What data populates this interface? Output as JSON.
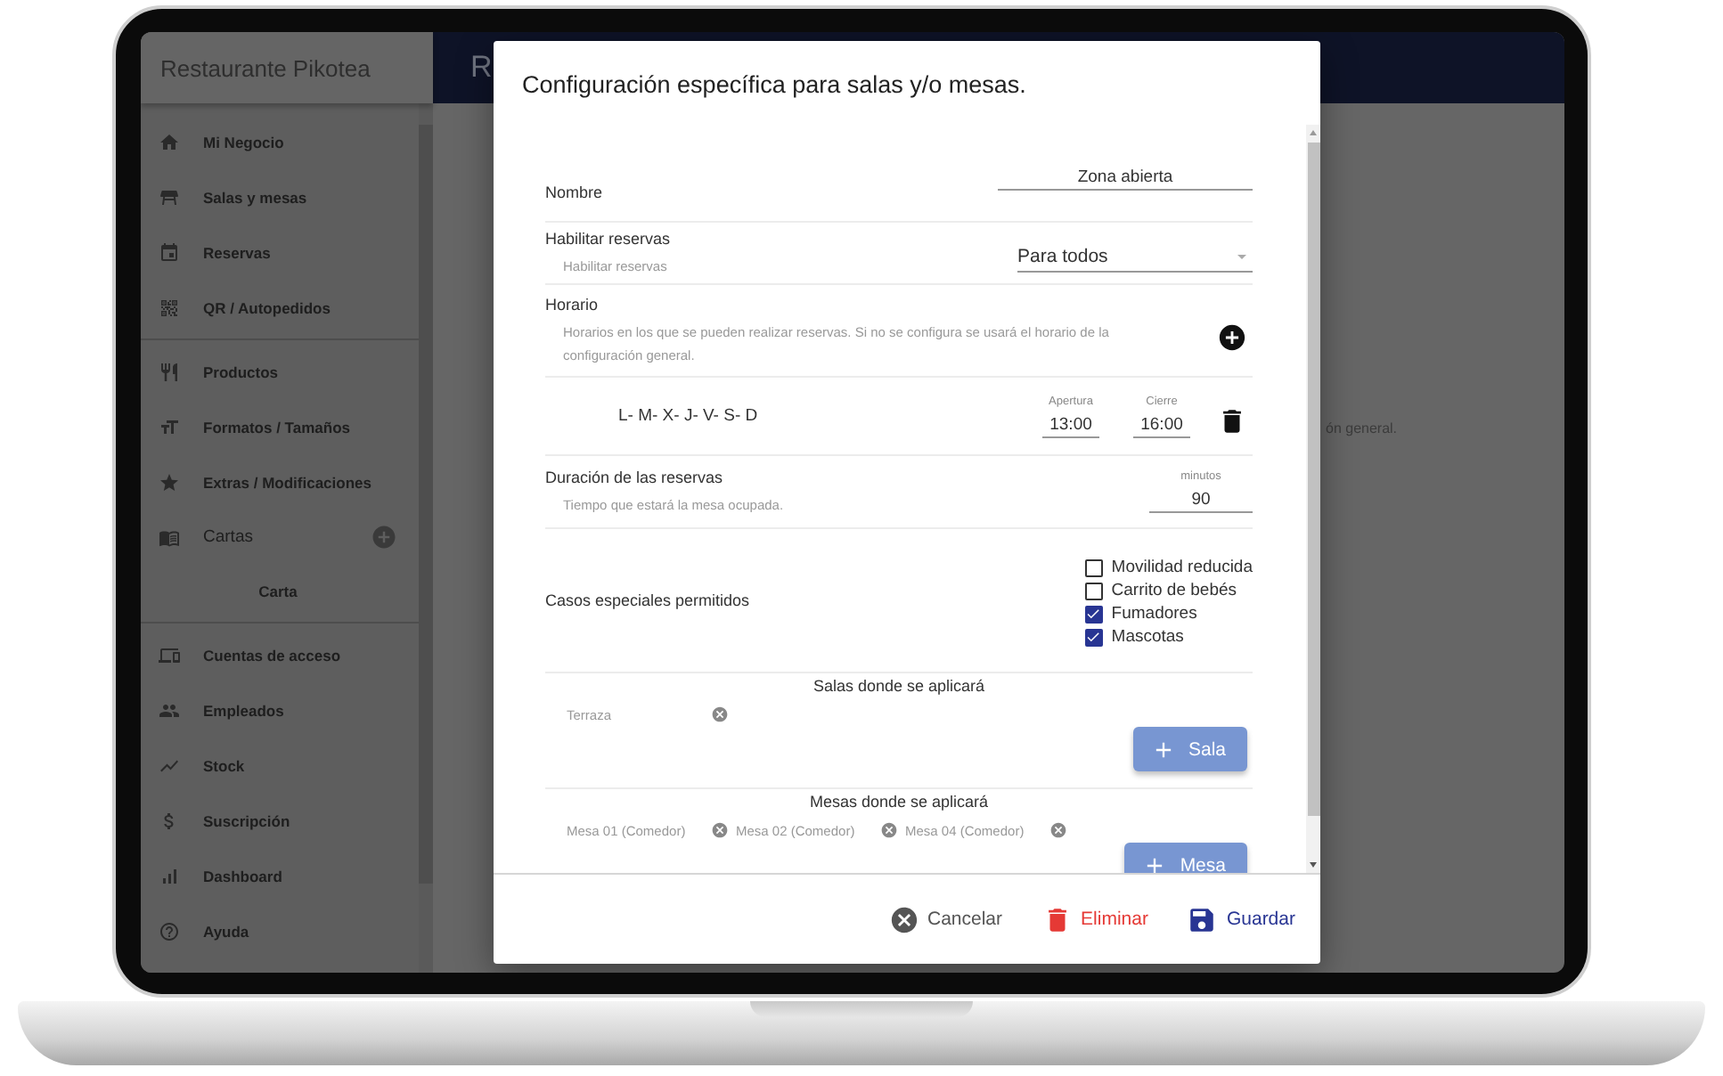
{
  "app": {
    "title": "Restaurante Pikotea",
    "page_title": "R",
    "background_text": "ón general."
  },
  "sidebar": {
    "items": [
      {
        "label": "Mi Negocio",
        "kind": "link",
        "divider_after": false
      },
      {
        "label": "Salas y mesas",
        "kind": "link",
        "divider_after": false
      },
      {
        "label": "Reservas",
        "kind": "link",
        "divider_after": false
      },
      {
        "label": "QR / Autopedidos",
        "kind": "link",
        "divider_after": true
      },
      {
        "label": "Productos",
        "kind": "link",
        "divider_after": false
      },
      {
        "label": "Formatos / Tamaños",
        "kind": "link",
        "divider_after": false
      },
      {
        "label": "Extras / Modificaciones",
        "kind": "link",
        "divider_after": false
      },
      {
        "label": "Cartas",
        "kind": "section",
        "has_add": true,
        "divider_after": false
      },
      {
        "label": "Carta",
        "kind": "subitem",
        "divider_after": true
      },
      {
        "label": "Cuentas de acceso",
        "kind": "link",
        "divider_after": false
      },
      {
        "label": "Empleados",
        "kind": "link",
        "divider_after": false
      },
      {
        "label": "Stock",
        "kind": "link",
        "divider_after": false
      },
      {
        "label": "Suscripción",
        "kind": "link",
        "divider_after": false
      },
      {
        "label": "Dashboard",
        "kind": "link",
        "divider_after": false
      },
      {
        "label": "Ayuda",
        "kind": "link",
        "divider_after": false
      }
    ]
  },
  "dialog": {
    "title": "Configuración específica para salas y/o mesas.",
    "name": {
      "label": "Nombre",
      "value": "Zona abierta"
    },
    "booking": {
      "label": "Habilitar reservas",
      "hint": "Habilitar reservas",
      "value": "Para todos"
    },
    "schedule": {
      "label": "Horario",
      "hint": "Horarios en los que se pueden realizar reservas. Si no se configura se usará el horario de la configuración general.",
      "slots": [
        {
          "days": "L- M- X- J- V- S- D",
          "open_label": "Apertura",
          "open": "13:00",
          "close_label": "Cierre",
          "close": "16:00"
        }
      ]
    },
    "duration": {
      "label": "Duración de las reservas",
      "hint": "Tiempo que estará la mesa ocupada.",
      "unit": "minutos",
      "value": "90"
    },
    "special": {
      "label": "Casos especiales permitidos",
      "options": [
        {
          "label": "Movilidad reducida",
          "checked": false
        },
        {
          "label": "Carrito de bebés",
          "checked": false
        },
        {
          "label": "Fumadores",
          "checked": true
        },
        {
          "label": "Mascotas",
          "checked": true
        }
      ]
    },
    "rooms": {
      "title": "Salas donde se aplicará",
      "chips": [
        "Terraza"
      ],
      "button": "Sala"
    },
    "tables": {
      "title": "Mesas donde se aplicará",
      "chips": [
        "Mesa 01 (Comedor)",
        "Mesa 02 (Comedor)",
        "Mesa 04 (Comedor)"
      ],
      "button": "Mesa"
    },
    "buttons": [
      {
        "label": "Cancelar",
        "kind": "cancel"
      },
      {
        "label": "Eliminar",
        "kind": "delete"
      },
      {
        "label": "Guardar",
        "kind": "save"
      }
    ]
  }
}
